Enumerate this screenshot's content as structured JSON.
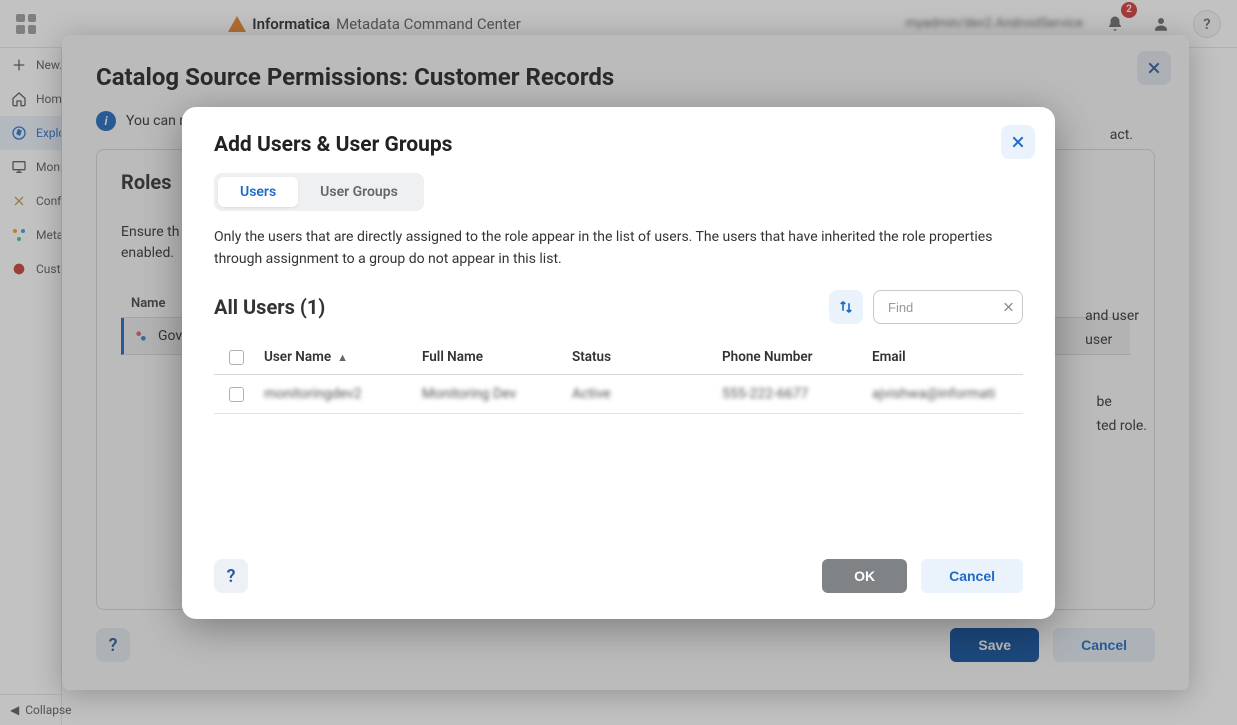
{
  "topbar": {
    "brand_name": "Informatica",
    "brand_sub": "Metadata Command Center",
    "account_text": "myadmin/dev2.AndroidService",
    "notification_count": "2"
  },
  "leftnav": {
    "items": [
      {
        "label": "New…",
        "icon": "plus"
      },
      {
        "label": "Home",
        "icon": "home"
      },
      {
        "label": "Explore",
        "icon": "compass",
        "active": true
      },
      {
        "label": "Monitor",
        "icon": "monitor"
      },
      {
        "label": "Configure",
        "icon": "tools"
      },
      {
        "label": "Metadata",
        "icon": "metadata"
      },
      {
        "label": "Customize",
        "icon": "customize"
      }
    ],
    "collapse_label": "Collapse"
  },
  "modal1": {
    "title": "Catalog Source Permissions: Customer Records",
    "info_text_left": "You can m",
    "info_text_right": "act.",
    "roles_title": "Roles",
    "roles_desc_line1": "Ensure th",
    "roles_desc_line2": "enabled.",
    "side_text_1": "and user",
    "side_text_2": "user",
    "side_text_3": "be",
    "side_text_4": "ted role.",
    "col_name": "Name",
    "row_label": "Gove",
    "save_label": "Save",
    "cancel_label": "Cancel"
  },
  "modal2": {
    "title": "Add Users & User Groups",
    "tabs": {
      "users": "Users",
      "groups": "User Groups"
    },
    "desc": "Only the users that are directly assigned to the role appear in the list of users. The users that have inherited the role properties through assignment to a group do not appear in this list.",
    "allusers_title": "All Users (1)",
    "search_placeholder": "Find",
    "columns": {
      "username": "User Name",
      "fullname": "Full Name",
      "status": "Status",
      "phone": "Phone Number",
      "email": "Email"
    },
    "rows": [
      {
        "username": "monitoringdev2",
        "fullname": "Monitoring Dev",
        "status": "Active",
        "phone": "555-222-6677",
        "email": "ajvishwa@informati"
      }
    ],
    "ok_label": "OK",
    "cancel_label": "Cancel"
  }
}
